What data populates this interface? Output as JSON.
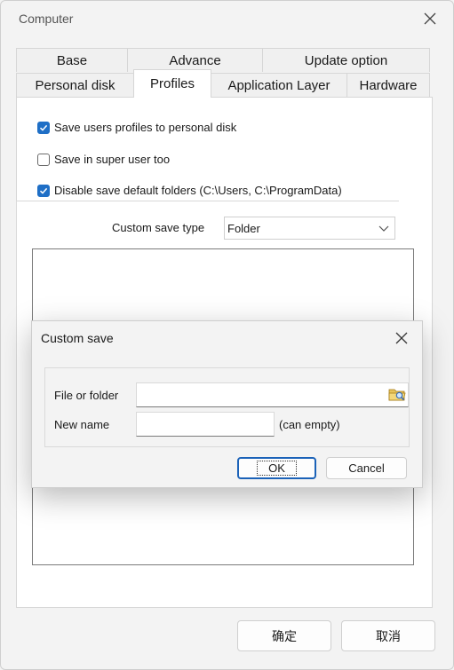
{
  "window": {
    "title": "Computer"
  },
  "tabs": {
    "row1": [
      "Base",
      "Advance",
      "Update option"
    ],
    "row2": [
      "Personal disk",
      "Profiles",
      "Application Layer",
      "Hardware"
    ],
    "active": "Profiles"
  },
  "options": [
    {
      "label": "Save users profiles to personal disk",
      "checked": true
    },
    {
      "label": "Save in super user too",
      "checked": false
    },
    {
      "label": "Disable save default folders (C:\\Users, C:\\ProgramData)",
      "checked": true
    }
  ],
  "custom_save_type": {
    "label": "Custom save type",
    "value": "Folder"
  },
  "footer": {
    "ok": "确定",
    "cancel": "取消"
  },
  "dialog": {
    "title": "Custom save",
    "file_label": "File or folder",
    "file_value": "",
    "name_label": "New name",
    "name_value": "",
    "name_hint": "(can empty)",
    "ok": "OK",
    "cancel": "Cancel"
  },
  "colors": {
    "accent": "#1f6fc6",
    "default_button_border": "#1b62b8"
  },
  "icons": [
    "close-icon",
    "chevron-down-icon",
    "checkmark-icon",
    "folder-browse-icon"
  ]
}
